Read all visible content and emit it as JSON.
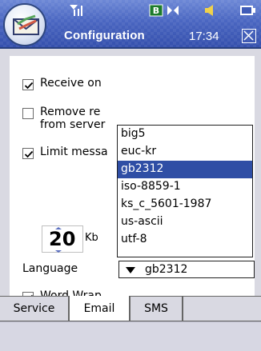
{
  "titlebar": {
    "title": "Configuration",
    "time": "17:34"
  },
  "options": {
    "receive_label": "Receive on",
    "remove_label_line1": "Remove re",
    "remove_label_line2": "from server",
    "limit_label": "Limit messa",
    "spin_value": "20",
    "spin_unit": "Kb",
    "language_label": "Language",
    "word_wrap_label": "Word Wrap"
  },
  "language": {
    "selected": "gb2312",
    "options": [
      "big5",
      "euc-kr",
      "gb2312",
      "iso-8859-1",
      "ks_c_5601-1987",
      "us-ascii",
      "utf-8"
    ]
  },
  "tabs": {
    "service": "Service",
    "email": "Email",
    "sms": "SMS"
  },
  "colors": {
    "selection": "#2f4ea5",
    "titlebar": "#3f5cb8"
  }
}
